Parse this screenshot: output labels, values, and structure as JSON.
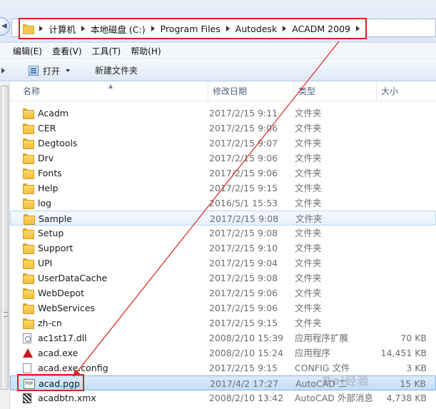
{
  "address_bar": {
    "crumbs": [
      "计算机",
      "本地磁盘 (C:)",
      "Program Files",
      "Autodesk",
      "ACADM 2009"
    ]
  },
  "menu": [
    "编辑(E)",
    "查看(V)",
    "工具(T)",
    "帮助(H)"
  ],
  "toolbar": {
    "open_label": "打开",
    "new_folder_label": "新建文件夹"
  },
  "columns": {
    "name": "名称",
    "date": "修改日期",
    "type": "类型",
    "size": "大小"
  },
  "files": [
    {
      "name": "Acadm",
      "date": "2017/2/15 9:11",
      "type": "文件夹",
      "size": "",
      "icon": "folder-icon"
    },
    {
      "name": "CER",
      "date": "2017/2/15 9:06",
      "type": "文件夹",
      "size": "",
      "icon": "folder-icon"
    },
    {
      "name": "Degtools",
      "date": "2017/2/15 9:07",
      "type": "文件夹",
      "size": "",
      "icon": "folder-icon"
    },
    {
      "name": "Drv",
      "date": "2017/2/15 9:06",
      "type": "文件夹",
      "size": "",
      "icon": "folder-icon"
    },
    {
      "name": "Fonts",
      "date": "2017/2/15 9:06",
      "type": "文件夹",
      "size": "",
      "icon": "folder-icon"
    },
    {
      "name": "Help",
      "date": "2017/2/15 9:15",
      "type": "文件夹",
      "size": "",
      "icon": "folder-icon"
    },
    {
      "name": "log",
      "date": "2016/5/1 15:53",
      "type": "文件夹",
      "size": "",
      "icon": "folder-icon"
    },
    {
      "name": "Sample",
      "date": "2017/2/15 9:08",
      "type": "文件夹",
      "size": "",
      "icon": "folder-icon"
    },
    {
      "name": "Setup",
      "date": "2017/2/15 9:08",
      "type": "文件夹",
      "size": "",
      "icon": "folder-icon"
    },
    {
      "name": "Support",
      "date": "2017/2/15 9:10",
      "type": "文件夹",
      "size": "",
      "icon": "folder-icon"
    },
    {
      "name": "UPI",
      "date": "2017/2/15 9:04",
      "type": "文件夹",
      "size": "",
      "icon": "folder-icon"
    },
    {
      "name": "UserDataCache",
      "date": "2017/2/15 9:08",
      "type": "文件夹",
      "size": "",
      "icon": "folder-icon"
    },
    {
      "name": "WebDepot",
      "date": "2017/2/15 9:06",
      "type": "文件夹",
      "size": "",
      "icon": "folder-icon"
    },
    {
      "name": "WebServices",
      "date": "2017/2/15 9:06",
      "type": "文件夹",
      "size": "",
      "icon": "folder-icon"
    },
    {
      "name": "zh-cn",
      "date": "2017/2/15 9:15",
      "type": "文件夹",
      "size": "",
      "icon": "folder-icon"
    },
    {
      "name": "ac1st17.dll",
      "date": "2008/2/10 15:39",
      "type": "应用程序扩展",
      "size": "70 KB",
      "icon": "dll-icon"
    },
    {
      "name": "acad.exe",
      "date": "2008/2/10 15:24",
      "type": "应用程序",
      "size": "14,451 KB",
      "icon": "autocad-exe-icon"
    },
    {
      "name": "acad.exe.config",
      "date": "2017/2/15 9:15",
      "type": "CONFIG 文件",
      "size": "3 KB",
      "icon": "config-file-icon"
    },
    {
      "name": "acad.pgp",
      "date": "2017/4/2 17:27",
      "type": "AutoCAD 二",
      "size": "15 KB",
      "icon": "pgp-file-icon"
    },
    {
      "name": "acadbtn.xmx",
      "date": "2008/2/10 13:42",
      "type": "AutoCAD 外部消息",
      "size": "4,738 KB",
      "icon": "xmx-file-icon"
    }
  ],
  "hover_index": 7,
  "selected_index": 18,
  "watermark": "Bai经验",
  "colors": {
    "annotation_red": "#d9241c",
    "selection_blue": "#c4ddfa"
  }
}
